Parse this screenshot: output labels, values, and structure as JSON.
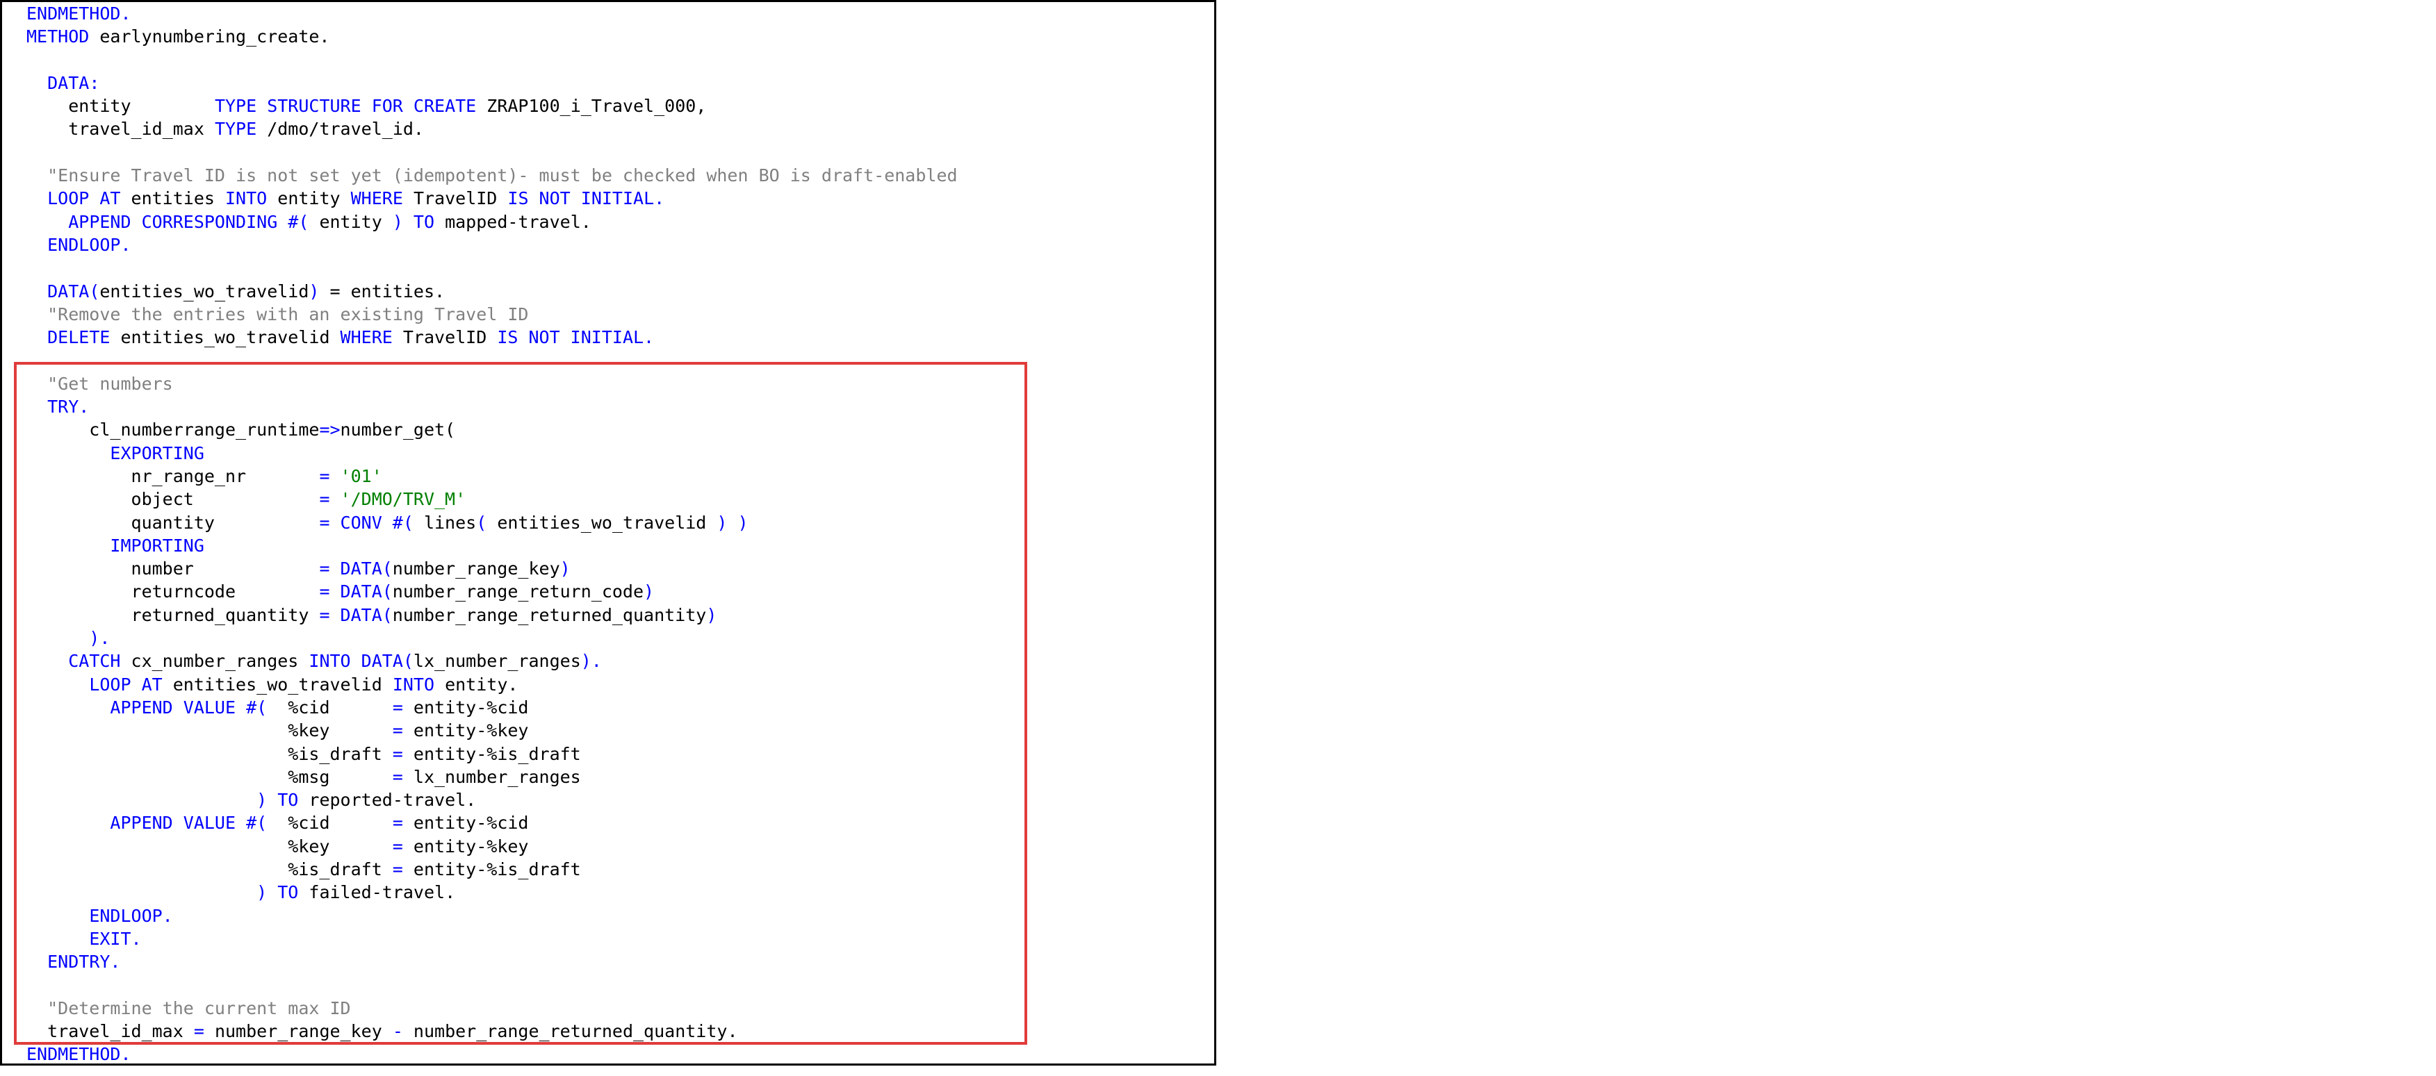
{
  "colors": {
    "keyword": "#0000ff",
    "comment": "#808080",
    "string": "#008000",
    "identifier": "#000000",
    "highlight_border": "#e03c3c",
    "panel_border": "#000000"
  },
  "code_lines": [
    [
      {
        "t": "ENDMETHOD.",
        "c": "kw"
      }
    ],
    [
      {
        "t": "METHOD ",
        "c": "kw"
      },
      {
        "t": "earlynumbering_create.",
        "c": "id"
      }
    ],
    [],
    [
      {
        "t": "  ",
        "c": "id"
      },
      {
        "t": "DATA:",
        "c": "kw"
      }
    ],
    [
      {
        "t": "    entity        ",
        "c": "id"
      },
      {
        "t": "TYPE STRUCTURE FOR CREATE ",
        "c": "kw"
      },
      {
        "t": "ZRAP100_i_Travel_000,",
        "c": "id"
      }
    ],
    [
      {
        "t": "    travel_id_max ",
        "c": "id"
      },
      {
        "t": "TYPE ",
        "c": "kw"
      },
      {
        "t": "/dmo/travel_id.",
        "c": "id"
      }
    ],
    [],
    [
      {
        "t": "  \"Ensure Travel ID is not set yet (idempotent)- must be checked when BO is draft-enabled",
        "c": "cm"
      }
    ],
    [
      {
        "t": "  ",
        "c": "id"
      },
      {
        "t": "LOOP AT ",
        "c": "kw"
      },
      {
        "t": "entities ",
        "c": "id"
      },
      {
        "t": "INTO ",
        "c": "kw"
      },
      {
        "t": "entity ",
        "c": "id"
      },
      {
        "t": "WHERE ",
        "c": "kw"
      },
      {
        "t": "TravelID ",
        "c": "id"
      },
      {
        "t": "IS NOT INITIAL.",
        "c": "kw"
      }
    ],
    [
      {
        "t": "    ",
        "c": "id"
      },
      {
        "t": "APPEND CORRESPONDING #( ",
        "c": "kw"
      },
      {
        "t": "entity ",
        "c": "id"
      },
      {
        "t": ") TO ",
        "c": "kw"
      },
      {
        "t": "mapped-travel.",
        "c": "id"
      }
    ],
    [
      {
        "t": "  ",
        "c": "id"
      },
      {
        "t": "ENDLOOP.",
        "c": "kw"
      }
    ],
    [],
    [
      {
        "t": "  ",
        "c": "id"
      },
      {
        "t": "DATA(",
        "c": "kw"
      },
      {
        "t": "entities_wo_travelid",
        "c": "id"
      },
      {
        "t": ") ",
        "c": "kw"
      },
      {
        "t": "= entities.",
        "c": "id"
      }
    ],
    [
      {
        "t": "  \"Remove the entries with an existing Travel ID",
        "c": "cm"
      }
    ],
    [
      {
        "t": "  ",
        "c": "id"
      },
      {
        "t": "DELETE ",
        "c": "kw"
      },
      {
        "t": "entities_wo_travelid ",
        "c": "id"
      },
      {
        "t": "WHERE ",
        "c": "kw"
      },
      {
        "t": "TravelID ",
        "c": "id"
      },
      {
        "t": "IS NOT INITIAL.",
        "c": "kw"
      }
    ],
    [],
    [
      {
        "t": "  \"Get numbers",
        "c": "cm"
      }
    ],
    [
      {
        "t": "  ",
        "c": "id"
      },
      {
        "t": "TRY.",
        "c": "kw"
      }
    ],
    [
      {
        "t": "      cl_numberrange_runtime",
        "c": "id"
      },
      {
        "t": "=>",
        "c": "kw"
      },
      {
        "t": "number_get(",
        "c": "id"
      }
    ],
    [
      {
        "t": "        ",
        "c": "id"
      },
      {
        "t": "EXPORTING",
        "c": "kw"
      }
    ],
    [
      {
        "t": "          nr_range_nr       ",
        "c": "id"
      },
      {
        "t": "= ",
        "c": "kw"
      },
      {
        "t": "'01'",
        "c": "st"
      }
    ],
    [
      {
        "t": "          object            ",
        "c": "id"
      },
      {
        "t": "= ",
        "c": "kw"
      },
      {
        "t": "'/DMO/TRV_M'",
        "c": "st"
      }
    ],
    [
      {
        "t": "          quantity          ",
        "c": "id"
      },
      {
        "t": "= CONV #( ",
        "c": "kw"
      },
      {
        "t": "lines",
        "c": "id"
      },
      {
        "t": "( ",
        "c": "kw"
      },
      {
        "t": "entities_wo_travelid ",
        "c": "id"
      },
      {
        "t": ") )",
        "c": "kw"
      }
    ],
    [
      {
        "t": "        ",
        "c": "id"
      },
      {
        "t": "IMPORTING",
        "c": "kw"
      }
    ],
    [
      {
        "t": "          number            ",
        "c": "id"
      },
      {
        "t": "= DATA(",
        "c": "kw"
      },
      {
        "t": "number_range_key",
        "c": "id"
      },
      {
        "t": ")",
        "c": "kw"
      }
    ],
    [
      {
        "t": "          returncode        ",
        "c": "id"
      },
      {
        "t": "= DATA(",
        "c": "kw"
      },
      {
        "t": "number_range_return_code",
        "c": "id"
      },
      {
        "t": ")",
        "c": "kw"
      }
    ],
    [
      {
        "t": "          returned_quantity ",
        "c": "id"
      },
      {
        "t": "= DATA(",
        "c": "kw"
      },
      {
        "t": "number_range_returned_quantity",
        "c": "id"
      },
      {
        "t": ")",
        "c": "kw"
      }
    ],
    [
      {
        "t": "      ).",
        "c": "kw"
      }
    ],
    [
      {
        "t": "    ",
        "c": "id"
      },
      {
        "t": "CATCH ",
        "c": "kw"
      },
      {
        "t": "cx_number_ranges ",
        "c": "id"
      },
      {
        "t": "INTO DATA(",
        "c": "kw"
      },
      {
        "t": "lx_number_ranges",
        "c": "id"
      },
      {
        "t": ").",
        "c": "kw"
      }
    ],
    [
      {
        "t": "      ",
        "c": "id"
      },
      {
        "t": "LOOP AT ",
        "c": "kw"
      },
      {
        "t": "entities_wo_travelid ",
        "c": "id"
      },
      {
        "t": "INTO ",
        "c": "kw"
      },
      {
        "t": "entity.",
        "c": "id"
      }
    ],
    [
      {
        "t": "        ",
        "c": "id"
      },
      {
        "t": "APPEND VALUE #(  ",
        "c": "kw"
      },
      {
        "t": "%cid      ",
        "c": "id"
      },
      {
        "t": "= ",
        "c": "kw"
      },
      {
        "t": "entity-%cid",
        "c": "id"
      }
    ],
    [
      {
        "t": "                         %key      ",
        "c": "id"
      },
      {
        "t": "= ",
        "c": "kw"
      },
      {
        "t": "entity-%key",
        "c": "id"
      }
    ],
    [
      {
        "t": "                         %is_draft ",
        "c": "id"
      },
      {
        "t": "= ",
        "c": "kw"
      },
      {
        "t": "entity-%is_draft",
        "c": "id"
      }
    ],
    [
      {
        "t": "                         %msg      ",
        "c": "id"
      },
      {
        "t": "= ",
        "c": "kw"
      },
      {
        "t": "lx_number_ranges",
        "c": "id"
      }
    ],
    [
      {
        "t": "                      ",
        "c": "id"
      },
      {
        "t": ") TO ",
        "c": "kw"
      },
      {
        "t": "reported-travel.",
        "c": "id"
      }
    ],
    [
      {
        "t": "        ",
        "c": "id"
      },
      {
        "t": "APPEND VALUE #(  ",
        "c": "kw"
      },
      {
        "t": "%cid      ",
        "c": "id"
      },
      {
        "t": "= ",
        "c": "kw"
      },
      {
        "t": "entity-%cid",
        "c": "id"
      }
    ],
    [
      {
        "t": "                         %key      ",
        "c": "id"
      },
      {
        "t": "= ",
        "c": "kw"
      },
      {
        "t": "entity-%key",
        "c": "id"
      }
    ],
    [
      {
        "t": "                         %is_draft ",
        "c": "id"
      },
      {
        "t": "= ",
        "c": "kw"
      },
      {
        "t": "entity-%is_draft",
        "c": "id"
      }
    ],
    [
      {
        "t": "                      ",
        "c": "id"
      },
      {
        "t": ") TO ",
        "c": "kw"
      },
      {
        "t": "failed-travel.",
        "c": "id"
      }
    ],
    [
      {
        "t": "      ",
        "c": "id"
      },
      {
        "t": "ENDLOOP.",
        "c": "kw"
      }
    ],
    [
      {
        "t": "      ",
        "c": "id"
      },
      {
        "t": "EXIT.",
        "c": "kw"
      }
    ],
    [
      {
        "t": "  ",
        "c": "id"
      },
      {
        "t": "ENDTRY.",
        "c": "kw"
      }
    ],
    [],
    [
      {
        "t": "  \"Determine the current max ID",
        "c": "cm"
      }
    ],
    [
      {
        "t": "  travel_id_max ",
        "c": "id"
      },
      {
        "t": "= ",
        "c": "kw"
      },
      {
        "t": "number_range_key ",
        "c": "id"
      },
      {
        "t": "- ",
        "c": "kw"
      },
      {
        "t": "number_range_returned_quantity.",
        "c": "id"
      }
    ],
    [
      {
        "t": "ENDMETHOD.",
        "c": "kw"
      }
    ]
  ]
}
